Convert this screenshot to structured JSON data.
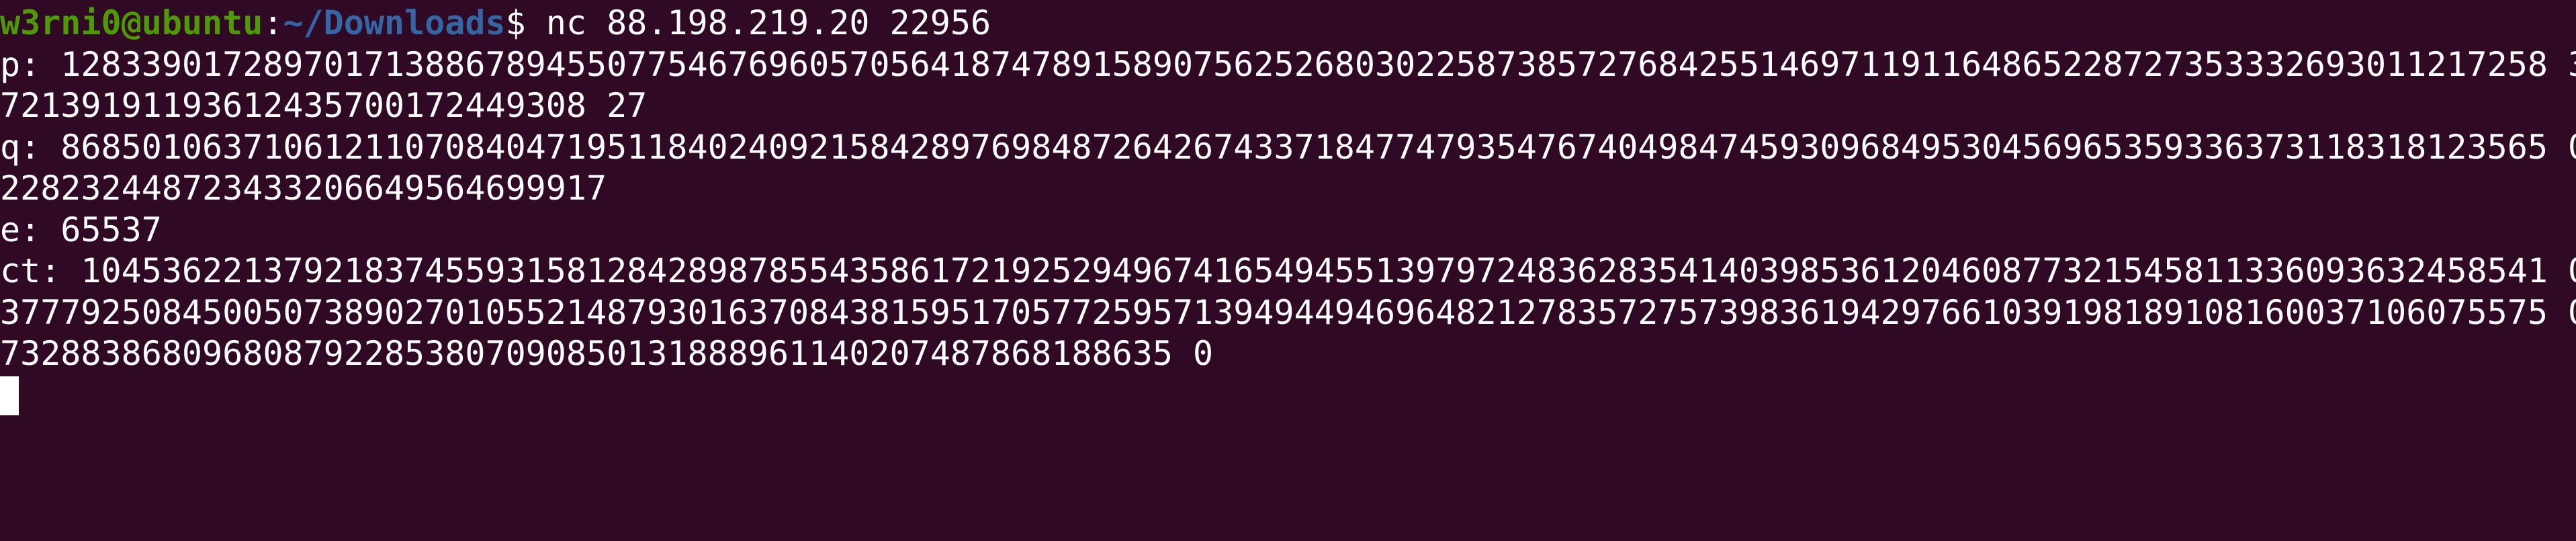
{
  "colors": {
    "background": "#300a24",
    "text": "#ffffff",
    "prompt_user": "#4e9a06",
    "prompt_path": "#3465a4",
    "cursor": "#ffffff"
  },
  "prompt": {
    "user_host": "w3rni0@ubuntu",
    "separator": ":",
    "path": "~/Downloads",
    "dollar": "$ ",
    "command": "nc 88.198.219.20 22956"
  },
  "output": [
    "p: 128339017289701713886789455077546769605705641874789158907562526803022587385727684255146971191164865228727353332693011217258 3",
    "72139191193612435700172449308 27",
    "q: 868501063710612110708404719511840240921584289769848726426743371847747935476740498474593096849530456965359336373118318123565 0",
    "228232448723433206649564699917",
    "e: 65537",
    "ct: 10453622137921837455931581284289878554358617219252949674165494551397972483628354140398536120460877321545811336093632458541 0",
    "377792508450050738902701055214879301637084381595170577259571394944946964821278357275739836194297661039198189108160037106075575 0",
    "7328838680968087922853807090850131888961140207487868188635 0"
  ]
}
